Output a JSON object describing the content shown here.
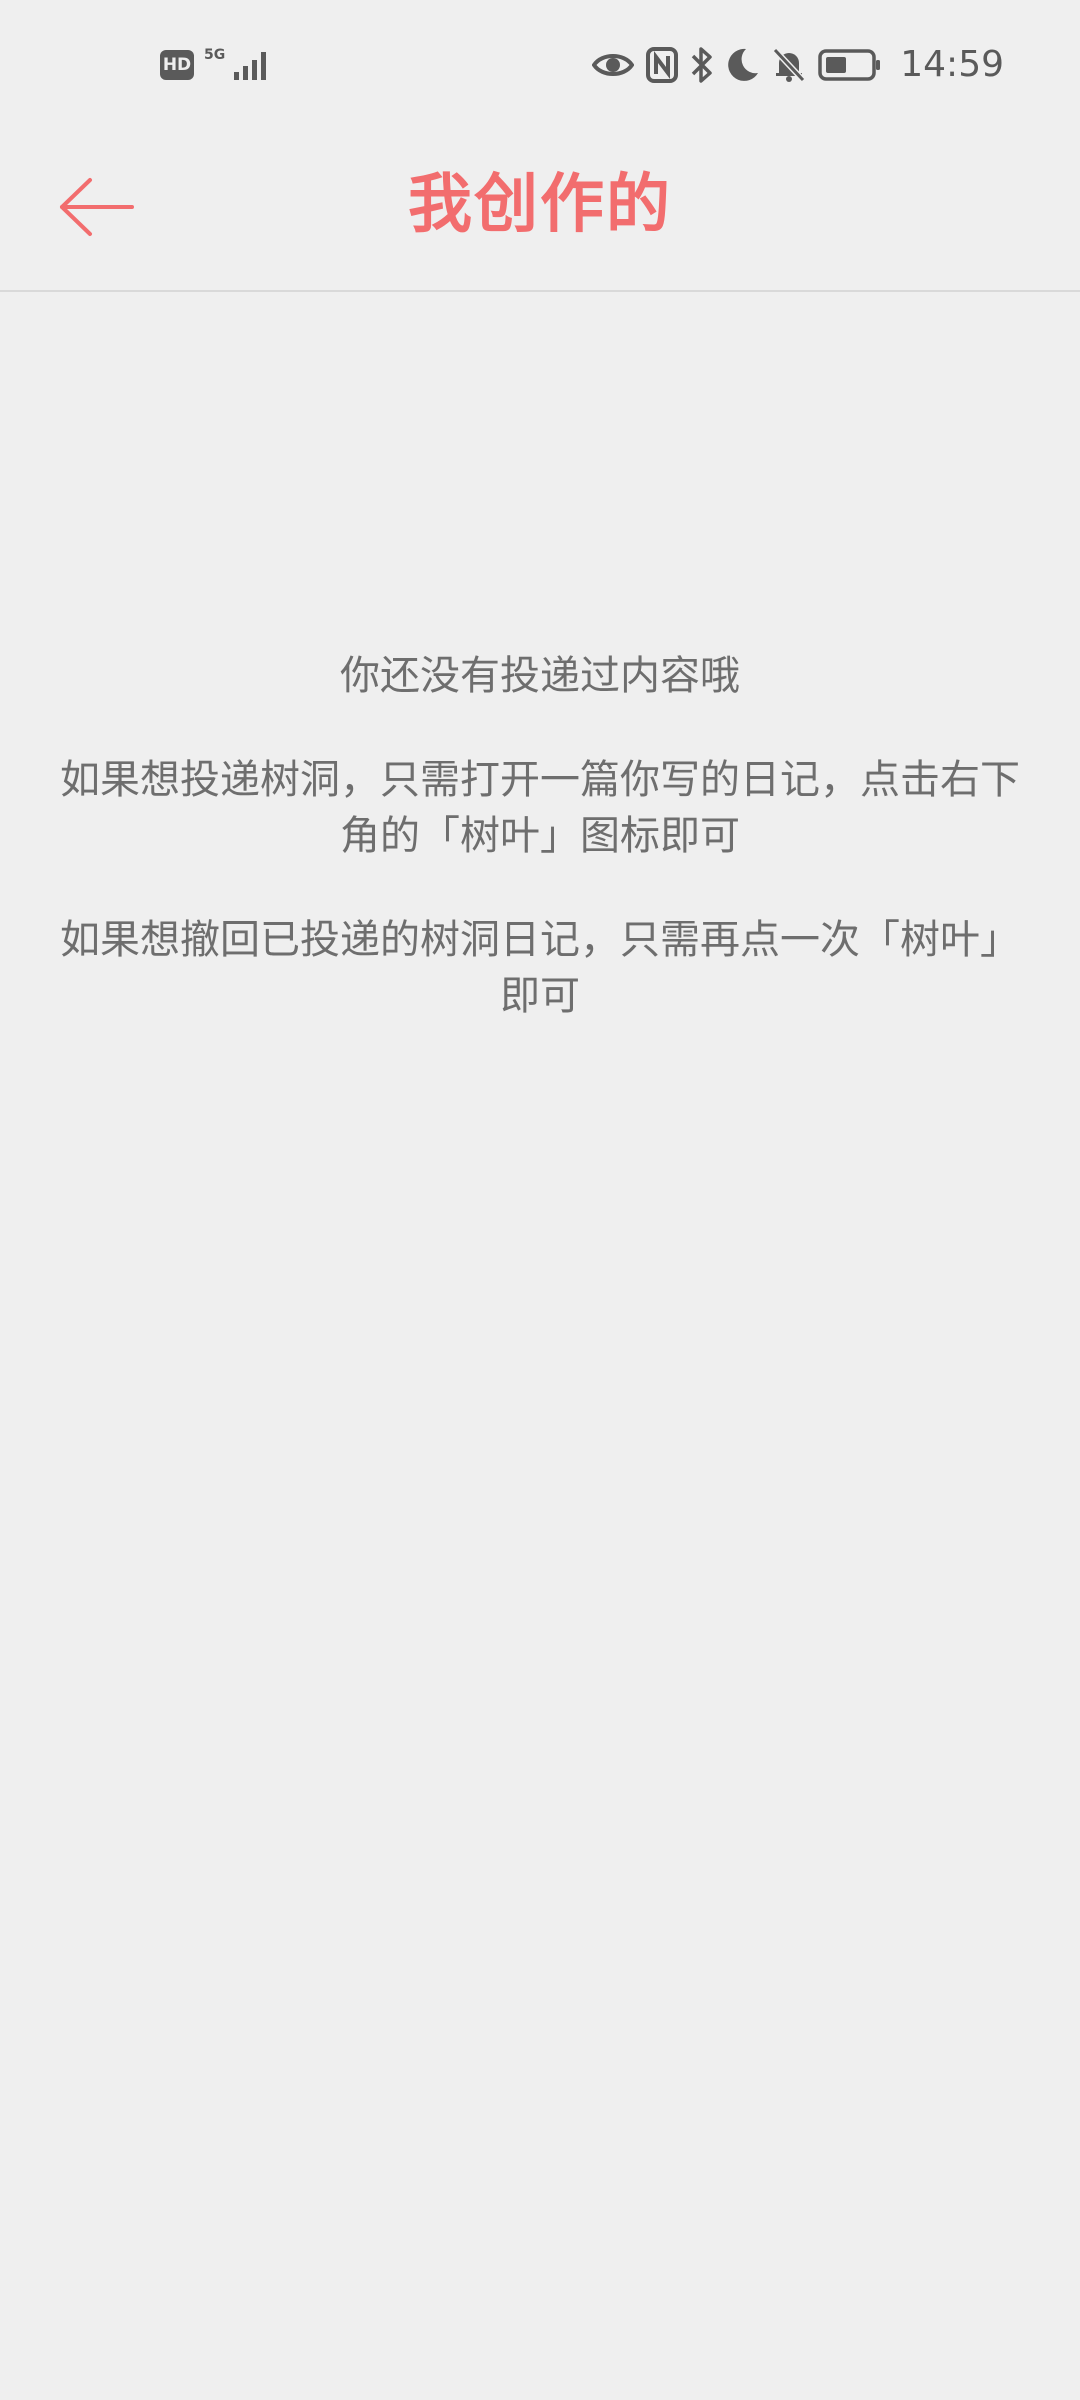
{
  "status_bar": {
    "network_badge": "HD",
    "signal_label": "5G",
    "time": "14:59",
    "icons": [
      "eye-comfort-icon",
      "nfc-icon",
      "bluetooth-icon",
      "do-not-disturb-moon-icon",
      "mute-bell-icon",
      "battery-icon"
    ]
  },
  "header": {
    "title": "我创作的",
    "back_icon": "arrow-left-icon",
    "accent_color": "#f26d6e"
  },
  "empty_state": {
    "line1": "你还没有投递过内容哦",
    "line2": "如果想投递树洞，只需打开一篇你写的日记，点击右下角的「树叶」图标即可",
    "line3": "如果想撤回已投递的树洞日记，只需再点一次「树叶」即可"
  }
}
